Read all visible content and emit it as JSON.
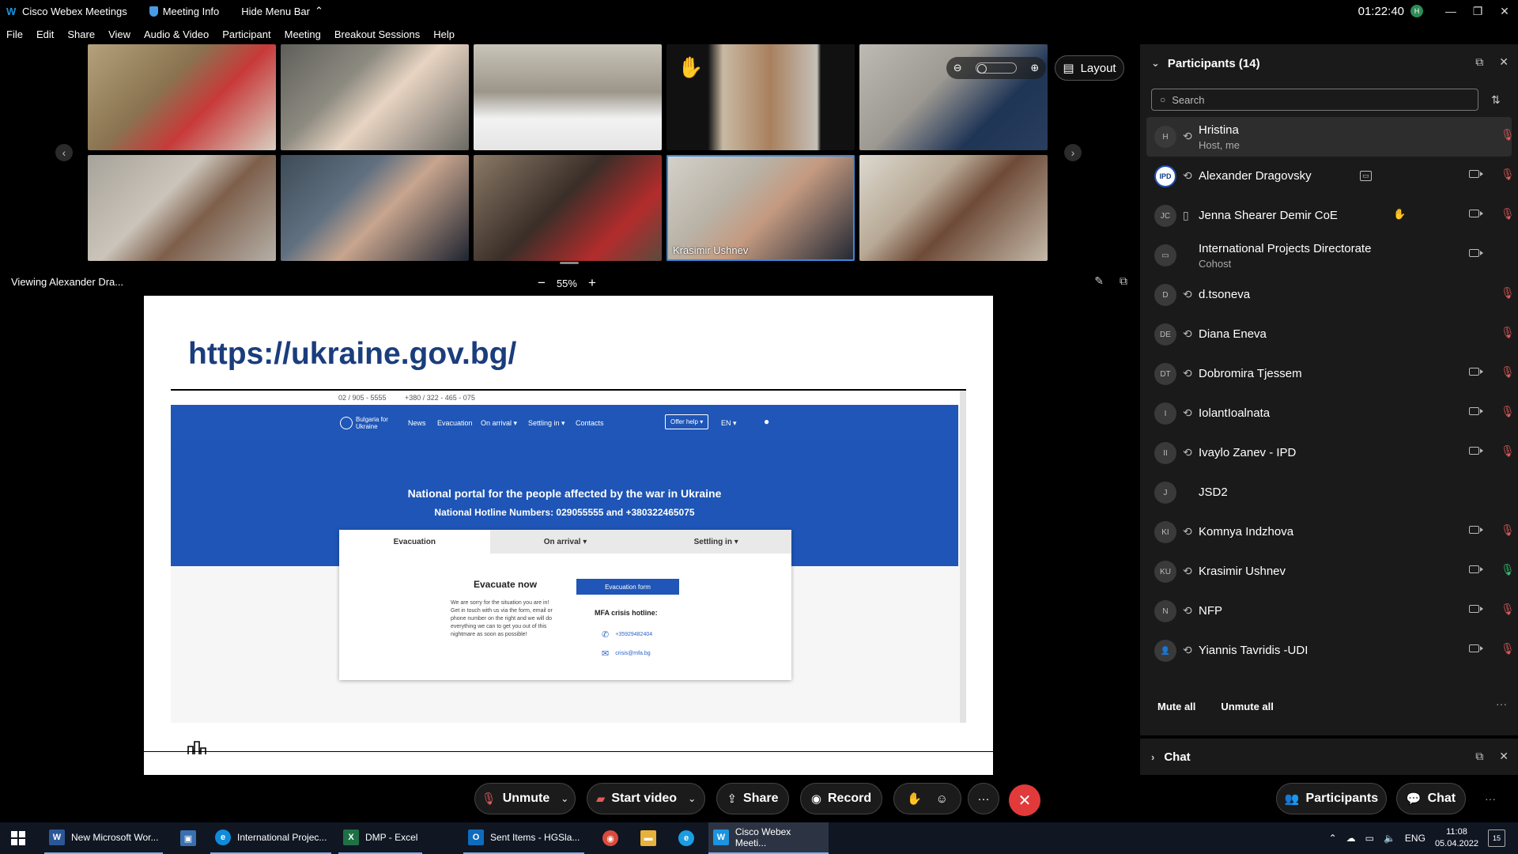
{
  "titlebar": {
    "app_name": "Cisco Webex Meetings",
    "meeting_info": "Meeting Info",
    "hide_menu": "Hide Menu Bar",
    "clock": "01:22:40",
    "presence_initial": "H"
  },
  "menu": [
    "File",
    "Edit",
    "Share",
    "View",
    "Audio & Video",
    "Participant",
    "Meeting",
    "Breakout Sessions",
    "Help"
  ],
  "videos": {
    "active_speaker_name": "Krasimir Ushnev",
    "layout_label": "Layout"
  },
  "viewbar": {
    "viewing": "Viewing Alexander Dra...",
    "zoom": "55%",
    "zoom_out": "−",
    "zoom_in": "+"
  },
  "slide": {
    "url": "https://ukraine.gov.bg/",
    "topbar_phone1": "02 / 905 - 5555",
    "topbar_phone2": "+380 / 322 - 465 - 075",
    "logo_line1": "Bulgaria for",
    "logo_line2": "Ukraine",
    "nav": [
      "News",
      "Evacuation",
      "On arrival ▾",
      "Settling in ▾",
      "Contacts"
    ],
    "offer_help": "Offer help ▾",
    "lang": "EN ▾",
    "hero_title": "National portal for the people affected by the war in Ukraine",
    "hero_sub": "National Hotline Numbers: 029055555 and +380322465075",
    "tabs": [
      "Evacuation",
      "On arrival ▾",
      "Settling in ▾"
    ],
    "evac_title": "Evacuate now",
    "evac_text": "We are sorry for the situation you are in! Get in touch with us via the form, email or phone number on the right and we will do everything we can to get you out of this nightmare as soon as possible!",
    "evac_button": "Evacuation form",
    "mfa_title": "MFA crisis hotline:",
    "mfa_phone": "+35929482404",
    "mfa_email": "crisis@mfa.bg"
  },
  "participants": {
    "header": "Participants (14)",
    "search_placeholder": "Search",
    "list": [
      {
        "initials": "H",
        "name": "Hristina",
        "role": "Host, me",
        "mic": "muted"
      },
      {
        "initials": "IPD",
        "name": "Alexander Dragovsky",
        "role": "",
        "mic": "muted"
      },
      {
        "initials": "JC",
        "name": "Jenna Shearer Demir CoE",
        "role": "",
        "mic": "muted"
      },
      {
        "initials": "▭",
        "name": "International Projects Directorate",
        "role": "Cohost",
        "mic": "none"
      },
      {
        "initials": "D",
        "name": "d.tsoneva",
        "role": "",
        "mic": "muted"
      },
      {
        "initials": "DE",
        "name": "Diana Eneva",
        "role": "",
        "mic": "muted"
      },
      {
        "initials": "DT",
        "name": "Dobromira Tjessem",
        "role": "",
        "mic": "muted"
      },
      {
        "initials": "I",
        "name": "IolantIoalnata",
        "role": "",
        "mic": "muted"
      },
      {
        "initials": "II",
        "name": "Ivaylo Zanev - IPD",
        "role": "",
        "mic": "muted"
      },
      {
        "initials": "J",
        "name": "JSD2",
        "role": "",
        "mic": "none"
      },
      {
        "initials": "KI",
        "name": "Komnya Indzhova",
        "role": "",
        "mic": "muted"
      },
      {
        "initials": "KU",
        "name": "Krasimir Ushnev",
        "role": "",
        "mic": "on"
      },
      {
        "initials": "N",
        "name": "NFP",
        "role": "",
        "mic": "muted"
      },
      {
        "initials": "👤",
        "name": "Yiannis Tavridis -UDI",
        "role": "",
        "mic": "muted"
      }
    ],
    "mute_all": "Mute all",
    "unmute_all": "Unmute all"
  },
  "chat_section": {
    "label": "Chat"
  },
  "controls": {
    "unmute": "Unmute",
    "start_video": "Start video",
    "share": "Share",
    "record": "Record",
    "participants": "Participants",
    "chat": "Chat"
  },
  "taskbar": {
    "apps": [
      {
        "label": "New Microsoft Wor...",
        "icon": "W",
        "color": "#2b5797"
      },
      {
        "label": "",
        "icon": "▣",
        "color": "#3a6fb0"
      },
      {
        "label": "International Projec...",
        "icon": "e",
        "color": "#0f8bd9"
      },
      {
        "label": "DMP - Excel",
        "icon": "X",
        "color": "#1e7145"
      },
      {
        "label": "Sent Items - HGSla...",
        "icon": "O",
        "color": "#0f6cbd"
      },
      {
        "label": "",
        "icon": "◉",
        "color": "#d94c3d"
      },
      {
        "label": "",
        "icon": "▬",
        "color": "#e8b23a"
      },
      {
        "label": "",
        "icon": "e",
        "color": "#1b9de2"
      },
      {
        "label": "Cisco Webex Meeti...",
        "icon": "W",
        "color": "#1c94e0"
      }
    ],
    "lang": "ENG",
    "time": "11:08",
    "date": "05.04.2022",
    "notif_count": "15"
  }
}
